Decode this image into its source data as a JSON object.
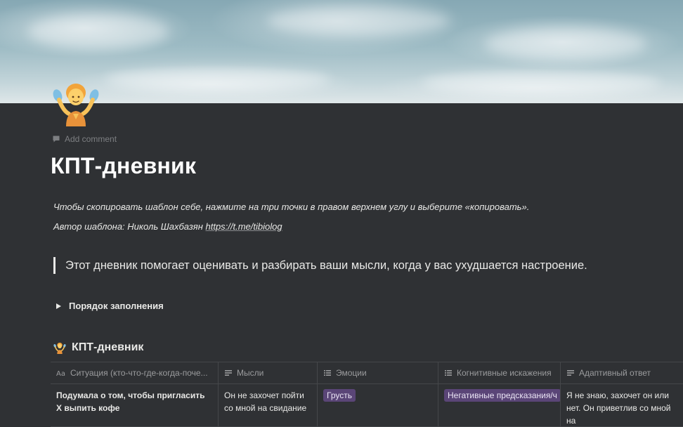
{
  "page": {
    "add_comment": "Add comment",
    "title": "КПТ-дневник",
    "intro_line1": "Чтобы скопировать шаблон себе, нажмите на три точки в правом верхнем углу и выберите «копировать».",
    "intro_line2_prefix": "Автор шаблона: Николь Шахбазян",
    "intro_link": "https://t.me/tibiolog",
    "quote": "Этот дневник помогает оценивать и разбирать ваши мысли, когда у вас ухудшается настроение.",
    "toggle_label": "Порядок заполнения"
  },
  "database": {
    "title": "КПТ-дневник",
    "columns": [
      {
        "label": "Ситуация (кто-что-где-когда-поче...",
        "icon": "text-property-icon"
      },
      {
        "label": "Мысли",
        "icon": "text-lines-icon"
      },
      {
        "label": "Эмоции",
        "icon": "multi-select-icon"
      },
      {
        "label": "Когнитивные искажения",
        "icon": "multi-select-icon"
      },
      {
        "label": "Адаптивный ответ",
        "icon": "text-lines-icon"
      }
    ],
    "rows": [
      {
        "situation": "Подумала о том, чтобы пригласить Х выпить кофе",
        "thoughts": "Он не захочет пойти со мной на свидание",
        "emotion_tag": "Грусть",
        "distortion_tag": "Негативные предсказания/ч",
        "answer": "Я не знаю, захочет он или нет. Он приветлив со мной на"
      }
    ]
  },
  "colors": {
    "background": "#2f3134",
    "tag_purple": "#5a4577",
    "text": "#e9e9e7",
    "muted": "#9b9c9e"
  }
}
